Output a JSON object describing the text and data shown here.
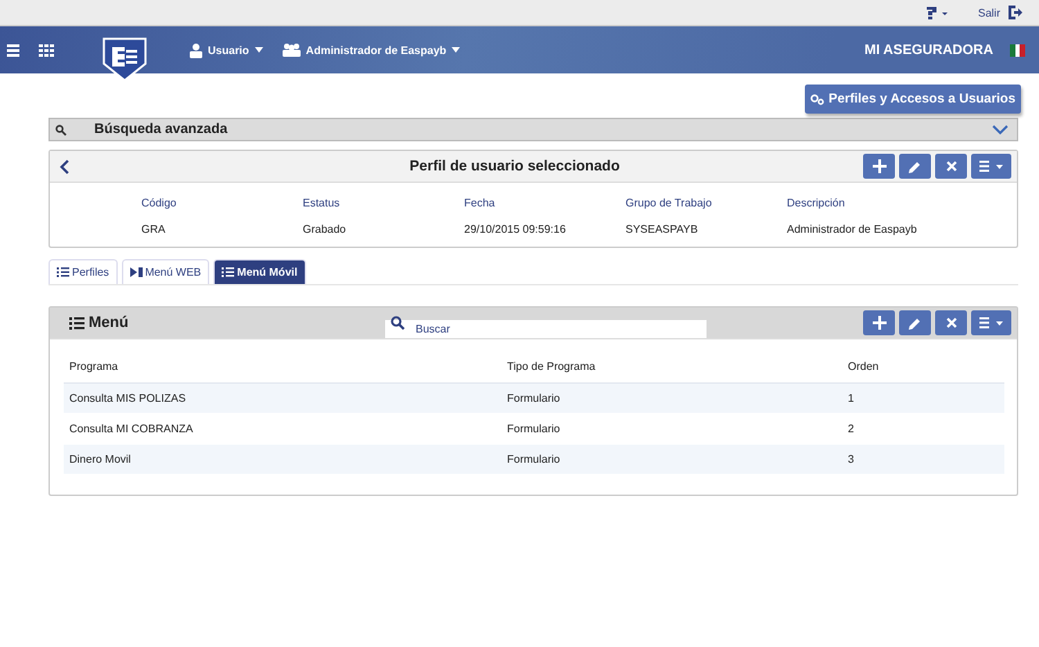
{
  "topbar": {
    "logout": "Salir"
  },
  "header": {
    "menus": [
      {
        "label": "Usuario",
        "kind": "user"
      },
      {
        "label": "Administrador de Easpayb",
        "kind": "group"
      }
    ],
    "company": "MI ASEGURADORA"
  },
  "action_button": "Perfiles y Accesos a Usuarios",
  "search_panel": {
    "title": "Búsqueda avanzada",
    "expanded": false
  },
  "profile": {
    "title": "Perfil de usuario seleccionado",
    "fields": [
      {
        "label": "Código",
        "value": "GRA"
      },
      {
        "label": "Estatus",
        "value": "Grabado"
      },
      {
        "label": "Fecha",
        "value": "29/10/2015 09:59:16"
      },
      {
        "label": "Grupo de Trabajo",
        "value": "SYSEASPAYB"
      },
      {
        "label": "Descripción",
        "value": "Administrador de Easpayb"
      }
    ]
  },
  "tabs": [
    {
      "label": "Perfiles",
      "kind": "list",
      "selected": false
    },
    {
      "label": "Menú WEB",
      "kind": "play",
      "selected": false
    },
    {
      "label": "Menú Móvil",
      "kind": "list",
      "selected": true
    }
  ],
  "menu_panel": {
    "title": "Menú",
    "search": {
      "placeholder": "Buscar"
    },
    "table": {
      "columns": [
        "Programa",
        "Tipo de Programa",
        "Orden"
      ],
      "rows": [
        [
          "Consulta MIS POLIZAS",
          "Formulario",
          "1"
        ],
        [
          "Consulta MI COBRANZA",
          "Formulario",
          "2"
        ],
        [
          "Dinero Movil",
          "Formulario",
          "3"
        ]
      ]
    }
  }
}
